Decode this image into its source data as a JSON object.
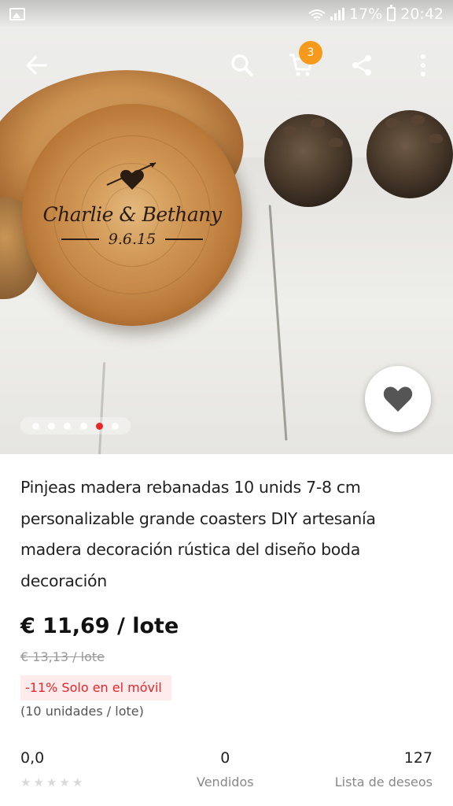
{
  "status_bar": {
    "battery": "17%",
    "time": "20:42"
  },
  "toolbar": {
    "icons": [
      "back-arrow-icon",
      "search-icon",
      "cart-icon",
      "share-icon",
      "more-vert-icon"
    ],
    "cart_count": "3"
  },
  "image": {
    "engraving_names": "Charlie & Bethany",
    "engraving_date": "9.6.15",
    "carousel_dots": 6,
    "carousel_active_index": 4
  },
  "product": {
    "title": "Pinjeas madera rebanadas 10 unids 7-8 cm personalizable grande coasters DIY artesanía madera decoración rústica del diseño boda decoración",
    "price": "€ 11,69 / lote",
    "old_price": "€ 13,13 / lote",
    "promo": "-11% Solo en el móvil",
    "units": "(10 unidades / lote)"
  },
  "stats": {
    "rating_value": "0,0",
    "rating_stars": 0,
    "sold_value": "0",
    "sold_label": "Vendidos",
    "wishlist_value": "127",
    "wishlist_label": "Lista de deseos"
  },
  "colors": {
    "accent_red": "#e8262b",
    "badge_orange": "#f59a1b"
  }
}
